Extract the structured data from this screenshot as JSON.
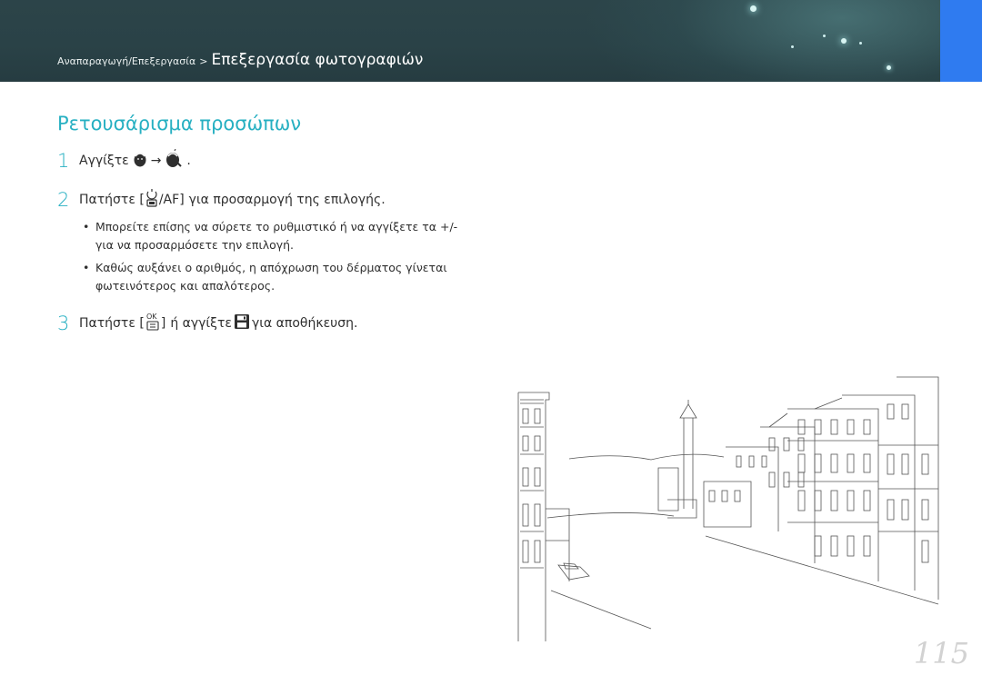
{
  "header": {
    "breadcrumb_parent": "Αναπαραγωγή/Επεξεργασία",
    "breadcrumb_separator": ">",
    "breadcrumb_current": "Επεξεργασία φωτογραφιών"
  },
  "section": {
    "title": "Ρετουσάρισμα προσώπων"
  },
  "steps": [
    {
      "number": "1",
      "prefix": "Αγγίξτε",
      "arrow": "→",
      "suffix": "."
    },
    {
      "number": "2",
      "prefix": "Πατήστε [",
      "key_label": "/AF]",
      "suffix": "για προσαρμογή της επιλογής."
    },
    {
      "number": "3",
      "prefix": "Πατήστε [",
      "key_label": "]",
      "middle": "ή αγγίξτε",
      "suffix": "για αποθήκευση."
    }
  ],
  "bullets": [
    "Μπορείτε επίσης να σύρετε το ρυθμιστικό ή να αγγίξετε τα +/- για να προσαρμόσετε την επιλογή.",
    "Καθώς αυξάνει ο αριθμός, η απόχρωση του δέρματος γίνεται φωτεινότερος και απαλότερος."
  ],
  "bullet_symbol": "•",
  "page_number": "115",
  "icons": {
    "face_retouch": "face-retouch-icon",
    "face_retouch_active": "face-retouch-active-icon",
    "timer_af": "timer-af-key-icon",
    "ok_key": "ok-menu-key-icon",
    "save": "save-icon"
  },
  "colors": {
    "header_bg": "#2a4247",
    "accent": "#27b0c2",
    "tab": "#2f7bf0",
    "page_number": "#d2d2d2"
  }
}
